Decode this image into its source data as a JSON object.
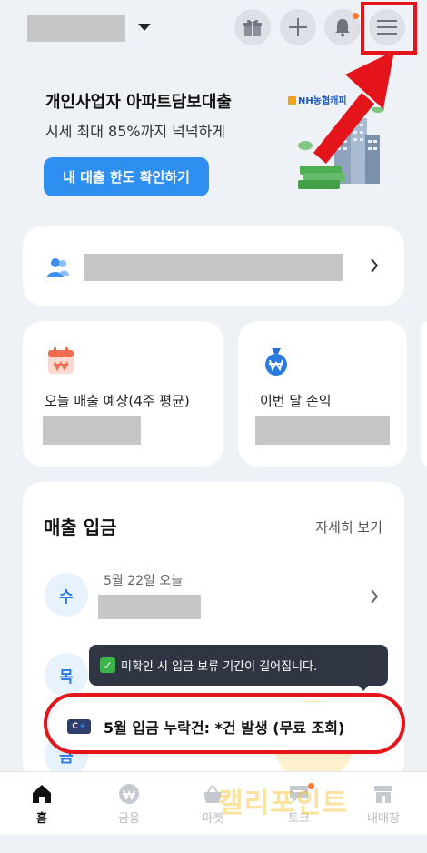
{
  "header": {
    "icons": [
      "gift-icon",
      "plus-icon",
      "bell-icon",
      "hamburger-menu-icon"
    ],
    "has_notification": true
  },
  "promo": {
    "title": "개인사업자 아파트담보대출",
    "subtitle": "시세 최대 85%까지 넉넉하게",
    "button_label": "내 대출 한도 확인하기",
    "brand_logo_text": "NH농협캐피"
  },
  "summary": {
    "sales_label": "오늘 매출 예상(4주 평균)",
    "profit_label": "이번 달 손익"
  },
  "deposits": {
    "title": "매출 입금",
    "more_label": "자세히 보기",
    "rows": [
      {
        "day": "수",
        "date": "5월 22일 오늘"
      },
      {
        "day": "목",
        "date": ""
      },
      {
        "day": "금",
        "date": ""
      }
    ]
  },
  "tooltip": {
    "text": "미확인 시 입금 보류 기간이 길어집니다."
  },
  "missing_deposit": {
    "icon_text": "C+",
    "text": "5월 입금 누락건: *건 발생 (무료 조회)"
  },
  "watermark": {
    "text": "캘리포인트"
  },
  "bottom_nav": {
    "items": [
      {
        "label": "홈",
        "icon": "home-icon",
        "active": true
      },
      {
        "label": "금융",
        "icon": "won-coin-icon",
        "active": false
      },
      {
        "label": "마켓",
        "icon": "basket-icon",
        "active": false
      },
      {
        "label": "토크",
        "icon": "chat-icon",
        "active": false,
        "badge": true
      },
      {
        "label": "내매장",
        "icon": "store-icon",
        "active": false
      }
    ]
  },
  "colors": {
    "primary": "#2f8ff0",
    "highlight_red": "#e5141b",
    "background": "#eef1f5"
  }
}
